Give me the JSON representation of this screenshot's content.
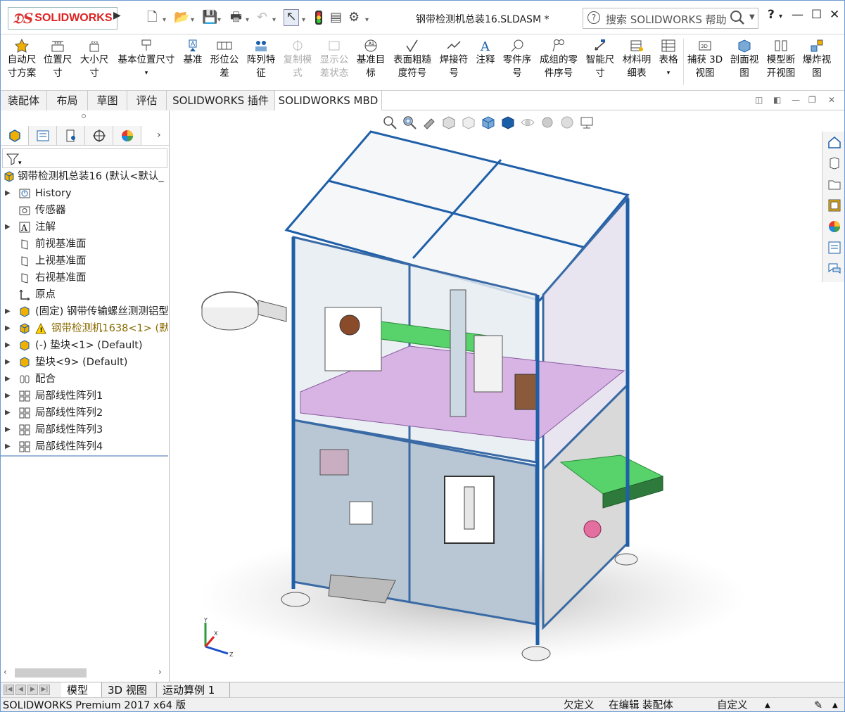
{
  "app": {
    "logo_text": "SOLIDWORKS",
    "document_title": "钢带检测机总装16.SLDASM *"
  },
  "search": {
    "placeholder": "搜索 SOLIDWORKS 帮助"
  },
  "window_controls": {
    "help": "?",
    "minimize": "—",
    "maximize": "☐",
    "close": "✕"
  },
  "toolbar": {
    "items": [
      {
        "label": "自动尺寸方案",
        "icon": "auto-dimension-icon",
        "enabled": true
      },
      {
        "label": "位置尺寸",
        "icon": "location-dimension-icon",
        "enabled": true
      },
      {
        "label": "大小尺寸",
        "icon": "size-dimension-icon",
        "enabled": true
      },
      {
        "label": "基本位置尺寸",
        "icon": "basic-location-dimension-icon",
        "enabled": true
      },
      {
        "label": "基准",
        "icon": "datum-icon",
        "enabled": true
      },
      {
        "label": "形位公差",
        "icon": "geometric-tolerance-icon",
        "enabled": true
      },
      {
        "label": "阵列特征",
        "icon": "pattern-feature-icon",
        "enabled": true
      },
      {
        "label": "复制模式",
        "icon": "copy-scheme-icon",
        "enabled": false
      },
      {
        "label": "显示公差状态",
        "icon": "tolerance-status-icon",
        "enabled": false
      },
      {
        "label": "基准目标",
        "icon": "datum-target-icon",
        "enabled": true
      },
      {
        "label": "表面粗糙度符号",
        "icon": "surface-finish-icon",
        "enabled": true
      },
      {
        "label": "焊接符号",
        "icon": "weld-symbol-icon",
        "enabled": true
      },
      {
        "label": "注释",
        "icon": "note-icon",
        "enabled": true
      },
      {
        "label": "零件序号",
        "icon": "balloon-icon",
        "enabled": true
      },
      {
        "label": "成组的零件序号",
        "icon": "stacked-balloon-icon",
        "enabled": true
      },
      {
        "label": "智能尺寸",
        "icon": "smart-dimension-icon",
        "enabled": true
      },
      {
        "label": "材料明细表",
        "icon": "bom-icon",
        "enabled": true
      },
      {
        "label": "表格",
        "icon": "table-icon",
        "enabled": true
      },
      {
        "label": "捕获 3D 视图",
        "icon": "capture-3d-view-icon",
        "enabled": true
      },
      {
        "label": "剖面视图",
        "icon": "section-view-icon",
        "enabled": true
      },
      {
        "label": "模型断开视图",
        "icon": "model-break-view-icon",
        "enabled": true
      },
      {
        "label": "爆炸视图",
        "icon": "exploded-view-icon",
        "enabled": true
      }
    ]
  },
  "command_tabs": [
    {
      "label": "装配体",
      "active": false
    },
    {
      "label": "布局",
      "active": false
    },
    {
      "label": "草图",
      "active": false
    },
    {
      "label": "评估",
      "active": false
    },
    {
      "label": "SOLIDWORKS 插件",
      "active": false
    },
    {
      "label": "SOLIDWORKS MBD",
      "active": true
    }
  ],
  "feature_tree": {
    "root": "钢带检测机总装16  (默认<默认_",
    "nodes": [
      {
        "label": "History",
        "icon": "history-icon",
        "expandable": true
      },
      {
        "label": "传感器",
        "icon": "sensor-icon",
        "expandable": false
      },
      {
        "label": "注解",
        "icon": "annotation-icon",
        "expandable": true
      },
      {
        "label": "前视基准面",
        "icon": "plane-icon",
        "expandable": false
      },
      {
        "label": "上视基准面",
        "icon": "plane-icon",
        "expandable": false
      },
      {
        "label": "右视基准面",
        "icon": "plane-icon",
        "expandable": false
      },
      {
        "label": "原点",
        "icon": "origin-icon",
        "expandable": false
      },
      {
        "label": "(固定) 钢带传输螺丝测测铝型",
        "icon": "part-icon",
        "expandable": true,
        "warning": false
      },
      {
        "label": "钢带检测机1638<1> (默",
        "icon": "assembly-icon",
        "expandable": true,
        "warning": true
      },
      {
        "label": "(-) 垫块<1> (Default)",
        "icon": "part-icon",
        "expandable": true,
        "warning": false
      },
      {
        "label": "垫块<9> (Default)",
        "icon": "part-icon",
        "expandable": true,
        "warning": false
      },
      {
        "label": "配合",
        "icon": "mate-icon",
        "expandable": true
      },
      {
        "label": "局部线性阵列1",
        "icon": "linear-pattern-icon",
        "expandable": true
      },
      {
        "label": "局部线性阵列2",
        "icon": "linear-pattern-icon",
        "expandable": true
      },
      {
        "label": "局部线性阵列3",
        "icon": "linear-pattern-icon",
        "expandable": true
      },
      {
        "label": "局部线性阵列4",
        "icon": "linear-pattern-icon",
        "expandable": true
      }
    ]
  },
  "bottom_tabs": [
    {
      "label": "模型",
      "active": true
    },
    {
      "label": "3D 视图",
      "active": false
    },
    {
      "label": "运动算例 1",
      "active": false
    }
  ],
  "status_bar": {
    "product": "SOLIDWORKS Premium 2017 x64 版",
    "definition": "欠定义",
    "mode": "在编辑 装配体",
    "units": "自定义",
    "triad": {
      "x": "X",
      "y": "Y",
      "z": "Z"
    }
  },
  "colors": {
    "frame_blue": "#1f5fa8",
    "accent_red": "#d32f2f",
    "glass_tint": "#e8ecef",
    "panel_gray": "#b8c7d3",
    "magenta": "#d7b4e4",
    "green_part": "#58d26a"
  }
}
